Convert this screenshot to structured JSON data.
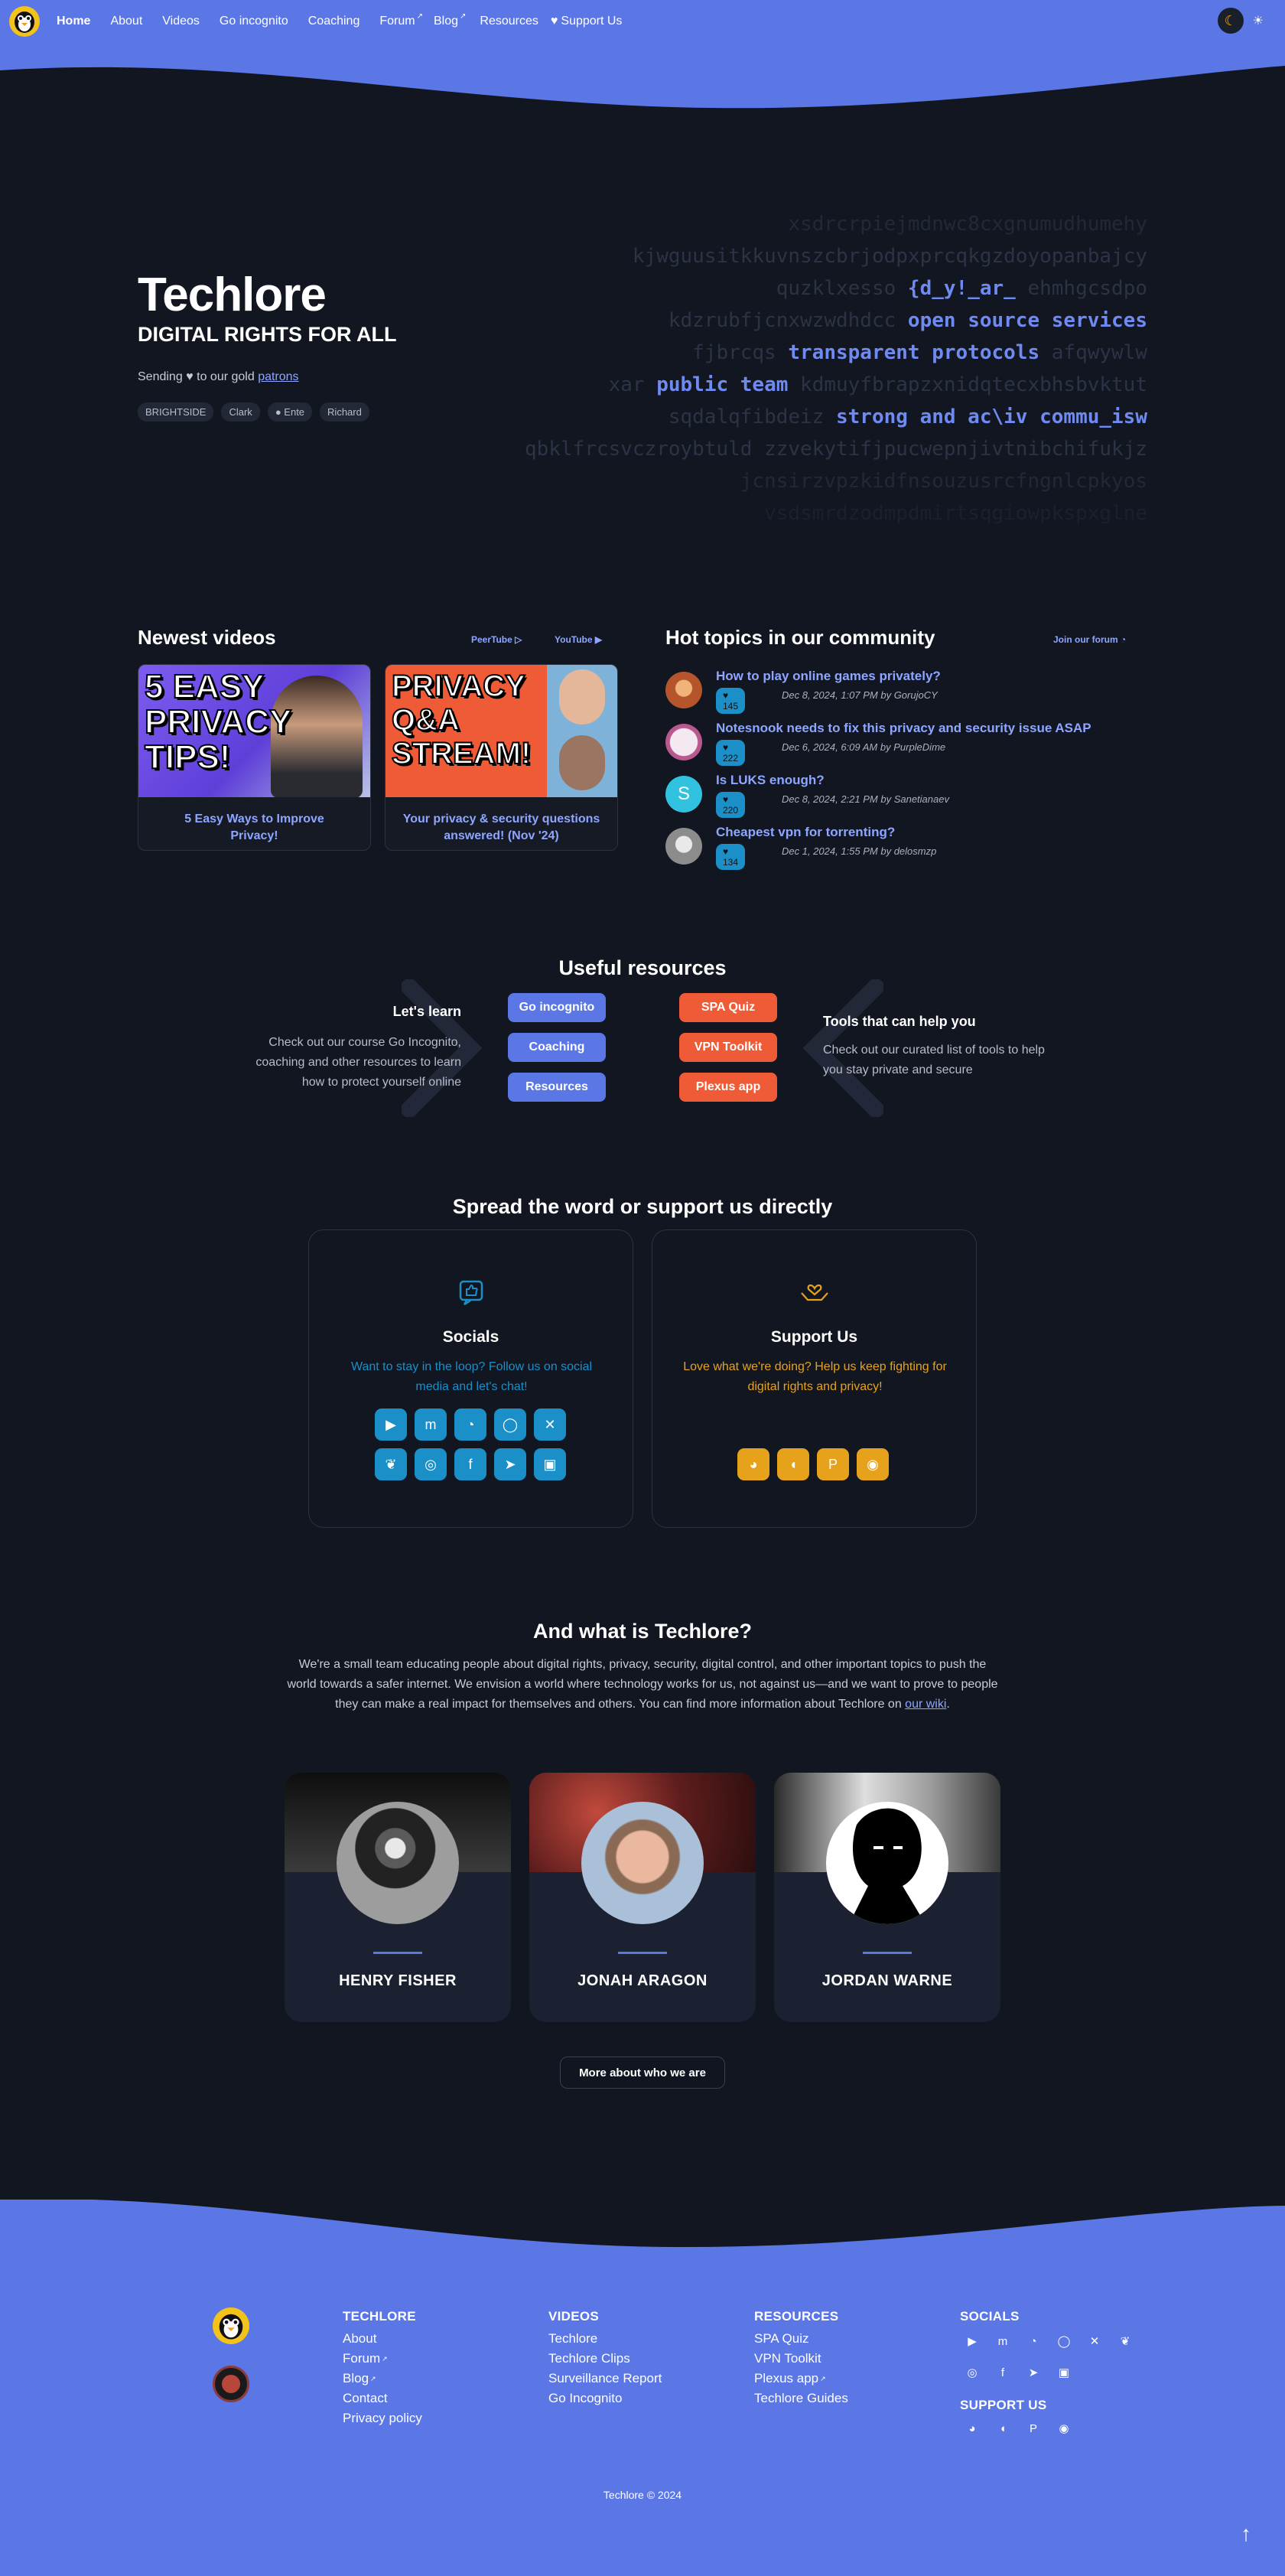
{
  "nav": {
    "items": [
      {
        "label": "Home",
        "active": true
      },
      {
        "label": "About"
      },
      {
        "label": "Videos"
      },
      {
        "label": "Go incognito"
      },
      {
        "label": "Coaching"
      },
      {
        "label": "Forum",
        "external": true
      },
      {
        "label": "Blog",
        "external": true
      },
      {
        "label": "Resources"
      },
      {
        "label": "Support Us"
      }
    ]
  },
  "hero": {
    "title": "Techlore",
    "subtitle": "DIGITAL RIGHTS FOR ALL",
    "sending_prefix": "Sending",
    "sending_mid": "to our gold",
    "patrons_link": "patrons",
    "patrons": [
      "BRIGHTSIDE",
      "Clark",
      "Ente",
      "Richard"
    ],
    "code_words": [
      "open source services",
      "transparent protocols",
      "public team",
      "strong and ac\\iv commu_isw",
      "{d_y!_ar_"
    ]
  },
  "videos": {
    "heading": "Newest videos",
    "peertube": "PeerTube",
    "youtube": "YouTube",
    "items": [
      {
        "thumb_text": "5 EASY PRIVACY TIPS!",
        "title": "5 Easy Ways to Improve Privacy!"
      },
      {
        "thumb_text": "PRIVACY Q&A STREAM!",
        "title": "Your privacy & security questions answered! (Nov '24)"
      }
    ]
  },
  "topics": {
    "heading": "Hot topics in our community",
    "join": "Join our forum",
    "items": [
      {
        "title": "How to play online games privately?",
        "count": "145",
        "meta": "Dec 8, 2024, 1:07 PM by GorujoCY"
      },
      {
        "title": "Notesnook needs to fix this privacy and security issue ASAP",
        "count": "222",
        "meta": "Dec 6, 2024, 6:09 AM by PurpleDime"
      },
      {
        "title": "Is LUKS enough?",
        "count": "220",
        "meta": "Dec 8, 2024, 2:21 PM by Sanetianaev"
      },
      {
        "title": "Cheapest vpn for torrenting?",
        "count": "134",
        "meta": "Dec 1, 2024, 1:55 PM by delosmzp"
      }
    ]
  },
  "resources": {
    "heading": "Useful resources",
    "learn_title": "Let's learn",
    "learn_text": "Check out our course Go Incognito, coaching and other resources to learn how to protect yourself online",
    "learn_buttons": [
      "Go incognito",
      "Coaching",
      "Resources"
    ],
    "tools_buttons": [
      "SPA Quiz",
      "VPN Toolkit",
      "Plexus app"
    ],
    "tools_title": "Tools that can help you",
    "tools_text": "Check out our curated list of tools to help you stay private and secure"
  },
  "spread": {
    "heading": "Spread the word or support us directly",
    "socials_title": "Socials",
    "socials_text": "Want to stay in the loop? Follow us on social media and let's chat!",
    "socials_icons": [
      "youtube-icon",
      "mastodon-icon",
      "rss-icon",
      "signal-icon",
      "x-icon",
      "bluesky-icon",
      "instagram-icon",
      "facebook-icon",
      "telegram-icon",
      "matrix-icon"
    ],
    "support_title": "Support Us",
    "support_text": "Love what we're doing? Help us keep fighting for digital rights and privacy!",
    "support_icons": [
      "liberapay-icon",
      "patreon-icon",
      "paypal-icon",
      "crypto-icon"
    ]
  },
  "about": {
    "heading": "And what is Techlore?",
    "text": "We're a small team educating people about digital rights, privacy, security, digital control, and other important topics to push the world towards a safer internet. We envision a world where technology works for us, not against us—and we want to prove to people they can make a real impact for themselves and others. You can find more information about Techlore on",
    "wiki": "our wiki",
    "team": [
      "HENRY FISHER",
      "JONAH ARAGON",
      "JORDAN WARNE"
    ],
    "more": "More about who we are"
  },
  "footer": {
    "techlore": {
      "title": "TECHLORE",
      "links": [
        "About",
        "Forum",
        "Blog",
        "Contact",
        "Privacy policy"
      ]
    },
    "videos": {
      "title": "VIDEOS",
      "links": [
        "Techlore",
        "Techlore Clips",
        "Surveillance Report",
        "Go Incognito"
      ]
    },
    "resources": {
      "title": "RESOURCES",
      "links": [
        "SPA Quiz",
        "VPN Toolkit",
        "Plexus app",
        "Techlore Guides"
      ]
    },
    "socials_title": "SOCIALS",
    "support_title": "SUPPORT US",
    "copyright": "Techlore © 2024"
  },
  "colors": {
    "accent": "#5b77e6",
    "background": "#121620",
    "orange": "#ef5b36",
    "social_blue": "#1b8fc8",
    "support_yellow": "#e7a21c"
  }
}
